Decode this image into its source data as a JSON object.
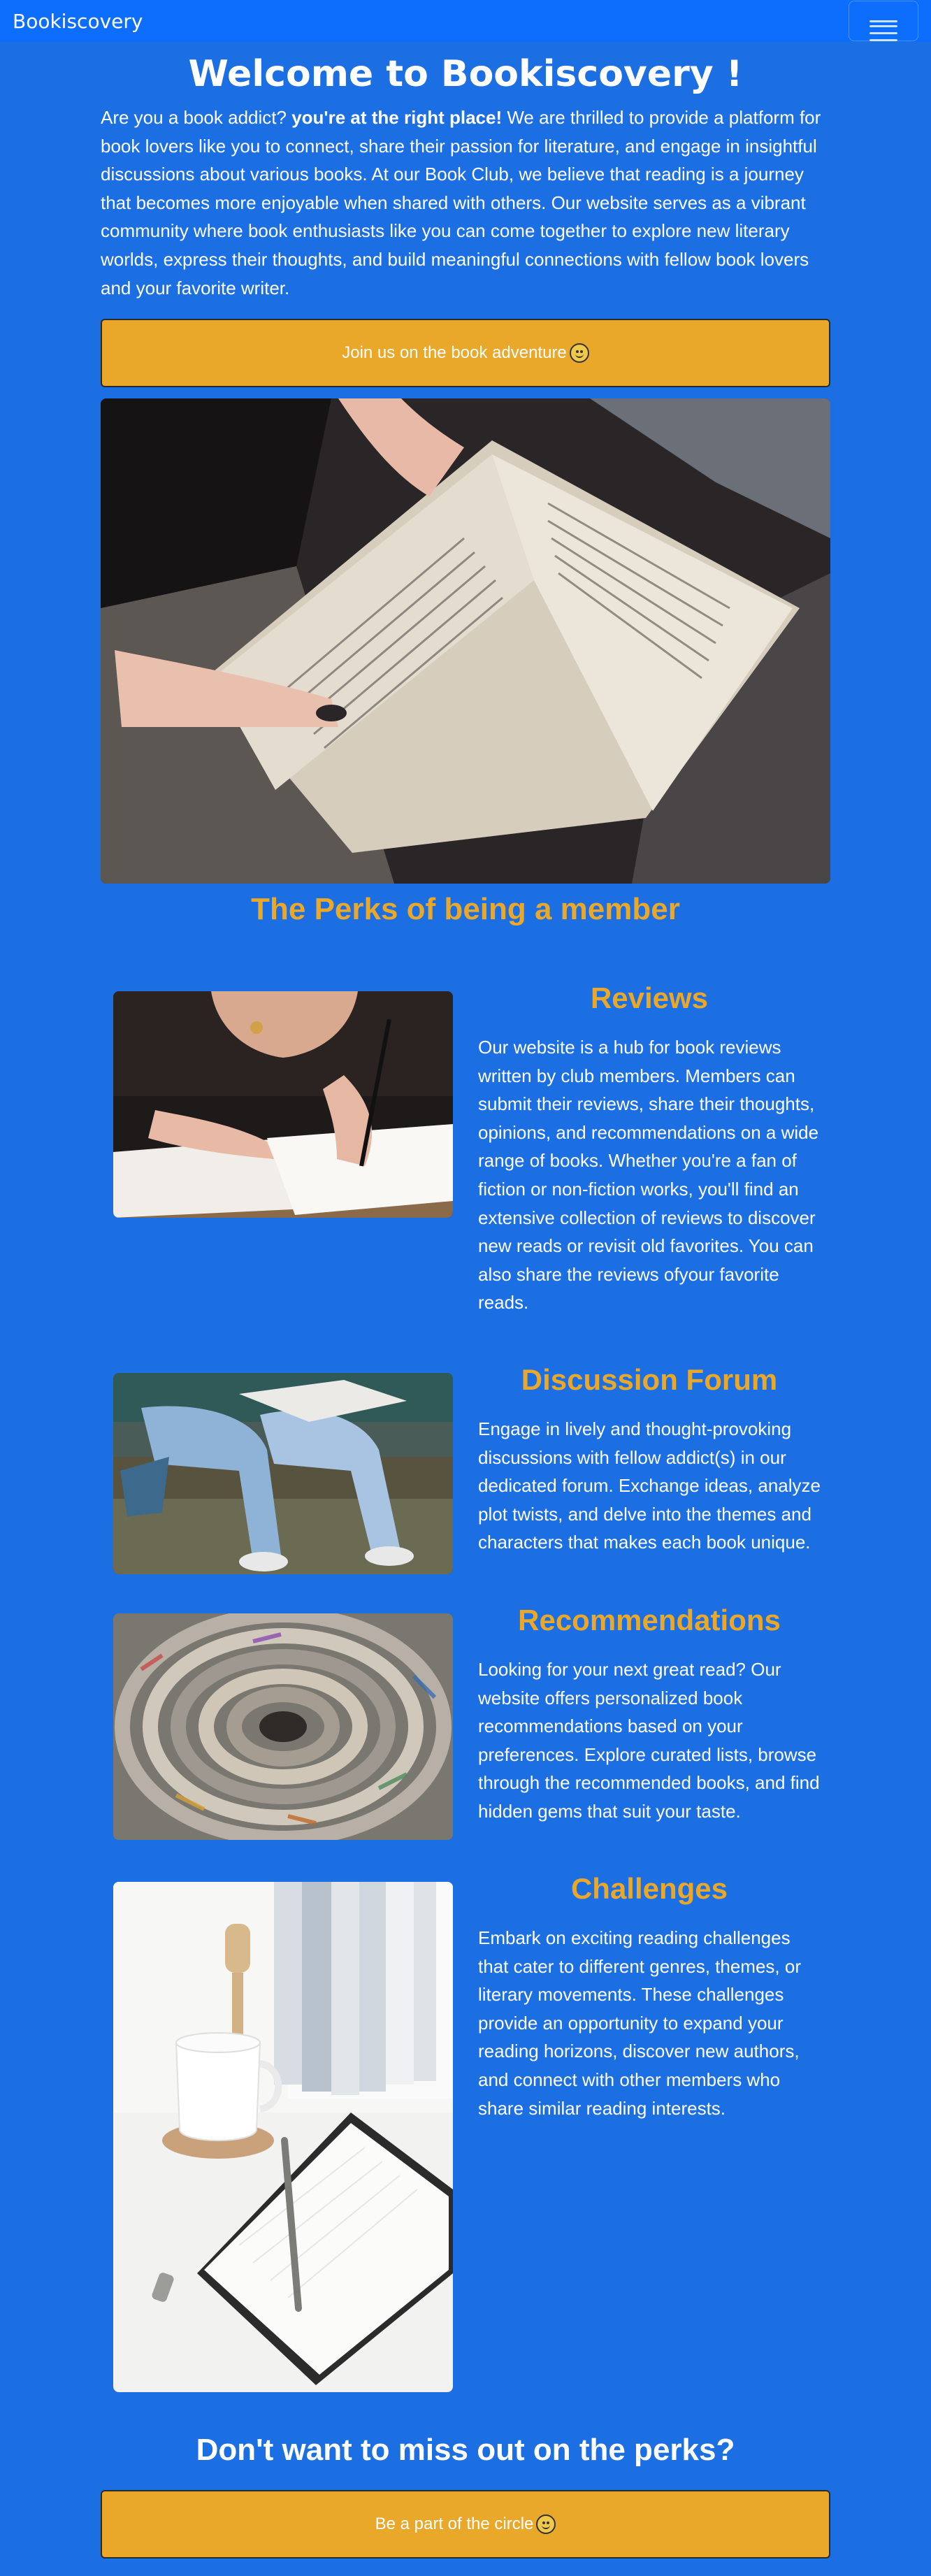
{
  "navbar": {
    "brand": "Bookiscovery",
    "toggle_icon": "hamburger-menu-icon"
  },
  "hero": {
    "title": "Welcome to Bookiscovery !",
    "intro_lead": "Are you a book addict?",
    "intro_bold": "you're at the right place!",
    "intro_rest": "We are thrilled to provide a platform for book lovers like you to connect, share their passion for literature, and engage in insightful discussions about various books. At our Book Club, we believe that reading is a journey that becomes more enjoyable when shared with others. Our website serves as a vibrant community where book enthusiasts like you can come together to explore new literary worlds, express their thoughts, and build meaningful connections with fellow book lovers and your favorite writer.",
    "cta_label": "Join us on the book adventure",
    "cta_icon": "smile-emoji-icon"
  },
  "perks": {
    "title": "The Perks of being a member",
    "features": [
      {
        "title": "Reviews",
        "text": "Our website is a hub for book reviews written by club members. Members can submit their reviews, share their thoughts, opinions, and recommendations on a wide range of books. Whether you're a fan of fiction or non-fiction works, you'll find an extensive collection of reviews to discover new reads or revisit old favorites. You can also share the reviews ofyour favorite reads."
      },
      {
        "title": "Discussion Forum",
        "text": "Engage in lively and thought-provoking discussions with fellow addict(s) in our dedicated forum. Exchange ideas, analyze plot twists, and delve into the themes and characters that makes each book unique."
      },
      {
        "title": "Recommendations",
        "text": "Looking for your next great read? Our website offers personalized book recommendations based on your preferences. Explore curated lists, browse through the recommended books, and find hidden gems that suit your taste."
      },
      {
        "title": "Challenges",
        "text": "Embark on exciting reading challenges that cater to different genres, themes, or literary movements. These challenges provide an opportunity to expand your reading horizons, discover new authors, and connect with other members who share similar reading interests."
      }
    ]
  },
  "footer_cta": {
    "title": "Don't want to miss out on the perks?",
    "button_label": "Be a part of the circle",
    "button_icon": "smile-emoji-icon"
  },
  "colors": {
    "background": "#1c6fe3",
    "navbar": "#0d6efd",
    "accent": "#e9a82a"
  }
}
